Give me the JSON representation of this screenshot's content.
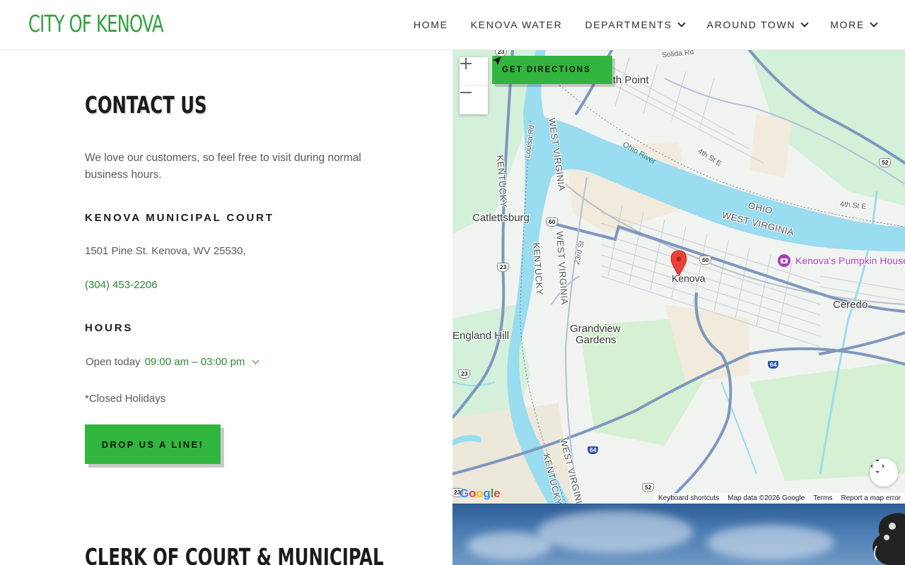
{
  "header": {
    "logo": "CITY OF KENOVA",
    "nav": [
      {
        "label": "HOME",
        "has_dropdown": false
      },
      {
        "label": "KENOVA WATER",
        "has_dropdown": false
      },
      {
        "label": "DEPARTMENTS",
        "has_dropdown": true
      },
      {
        "label": "AROUND TOWN",
        "has_dropdown": true
      },
      {
        "label": "MORE",
        "has_dropdown": true
      }
    ]
  },
  "contact": {
    "title": "CONTACT US",
    "intro": "We love our customers, so feel free to visit during normal business hours.",
    "court_heading": "KENOVA MUNICIPAL COURT",
    "address": "1501 Pine St. Kenova, WV 25530,",
    "phone": "(304) 453-2206",
    "hours_heading": "HOURS",
    "hours_label": "Open today",
    "hours_value": "09:00 am – 03:00 pm",
    "closed_note": "*Closed Holidays",
    "cta_label": "DROP US A LINE!"
  },
  "next_section": {
    "title": "CLERK OF COURT & MUNICIPAL"
  },
  "map": {
    "directions_label": "GET DIRECTIONS",
    "zoom_in": "+",
    "zoom_out": "−",
    "google_logo": "Google",
    "attribution": {
      "shortcuts": "Keyboard shortcuts",
      "map_data": "Map data ©2026 Google",
      "terms": "Terms",
      "report": "Report a map error"
    },
    "labels": {
      "south_point": "South Point",
      "solida_rd": "Solida Rd",
      "ohio_river": "Ohio River",
      "fourth_st_e": "4th St E",
      "fourth_st_e_2": "4th St E",
      "ohio": "OHIO",
      "west_virginia": "WEST VIRGINIA",
      "catlettsburg": "Catlettsburg",
      "kentucky_1": "KENTUCKY",
      "west_virginia_1": "WEST VIRGINIA",
      "louisa_rd": "Louisa Rd",
      "kentucky_2": "KENTUCKY",
      "west_virginia_2": "WEST VIRGINIA",
      "twenty_third_st": "23rd St",
      "kenova": "Kenova",
      "pumpkin_house": "Kenova's Pumpkin House",
      "ceredo": "Ceredo",
      "england_hill": "England Hill",
      "grandview": "Grandview",
      "gardens": "Gardens",
      "kentucky_3": "KENTUCKY",
      "west_virginia_3": "WEST VIRGINIA"
    },
    "shields": {
      "us23_top": "23",
      "us52_right": "52",
      "us60_west": "60",
      "us60_east": "60",
      "us23_mid": "23",
      "i64_east": "64",
      "us23_low": "23",
      "i64_south": "64",
      "us52_bottom": "52",
      "us23_bottom": "23"
    },
    "colors": {
      "water": "#9adcf0",
      "road_major": "#7e97bd",
      "park": "#d3f2d9",
      "marker": "#ea4335"
    }
  },
  "colors": {
    "brand_green": "#32b53e",
    "logo_green": "#30a13a",
    "link_green": "#2b8a33"
  }
}
